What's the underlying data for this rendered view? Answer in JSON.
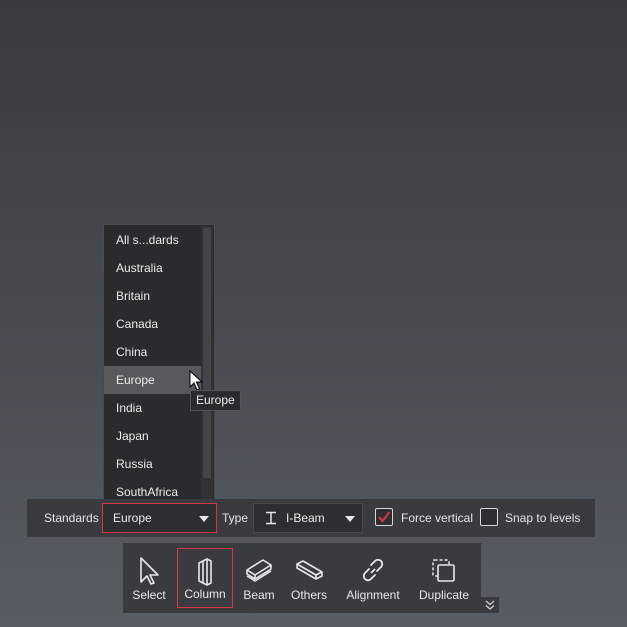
{
  "dropdown": {
    "items": [
      "All s...dards",
      "Australia",
      "Britain",
      "Canada",
      "China",
      "Europe",
      "India",
      "Japan",
      "Russia",
      "SouthAfrica"
    ],
    "hovered": "Europe"
  },
  "tooltip": {
    "text": "Europe"
  },
  "standards_bar": {
    "standards_label": "Standards",
    "standards_value": "Europe",
    "type_label": "Type",
    "type_value": "I-Beam",
    "force_vertical_label": "Force vertical",
    "force_vertical_checked": true,
    "snap_levels_label": "Snap to levels",
    "snap_levels_checked": false
  },
  "tools": {
    "select": "Select",
    "column": "Column",
    "beam": "Beam",
    "others": "Others",
    "alignment": "Alignment",
    "duplicate": "Duplicate",
    "active": "Column"
  },
  "colors": {
    "accent": "#d8344e",
    "panel": "#3a3b3e",
    "list_bg": "#2b2b2d"
  }
}
